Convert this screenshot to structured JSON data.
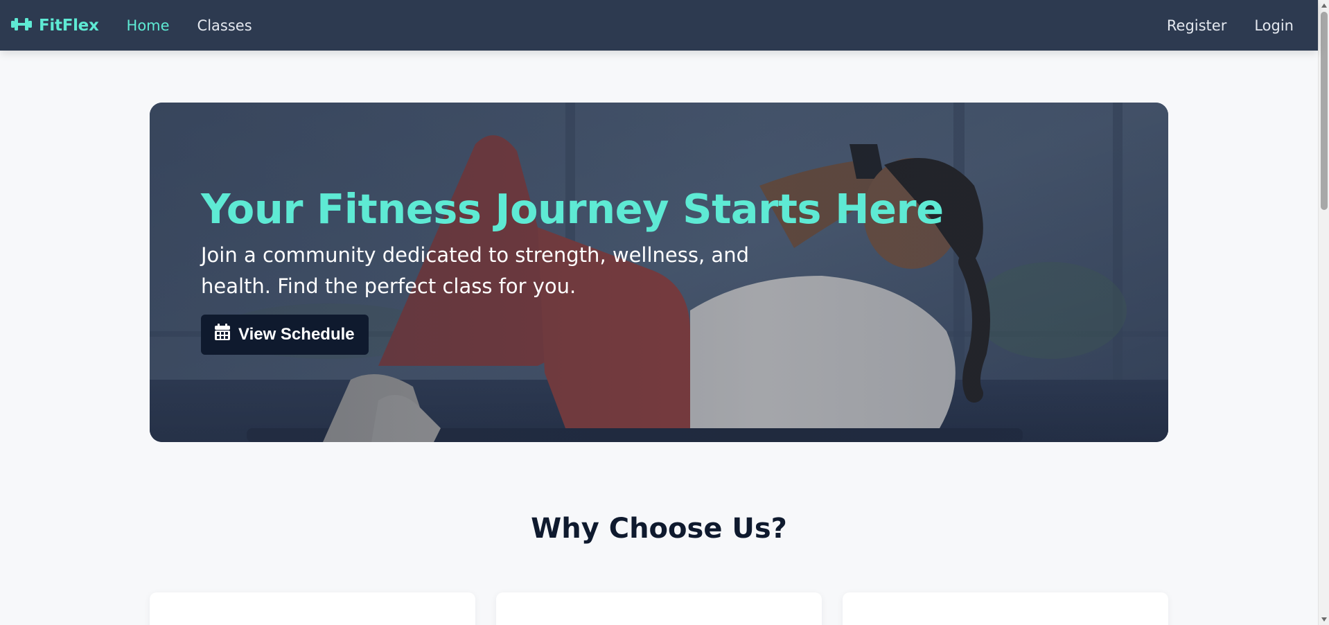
{
  "navbar": {
    "brand": "FitFlex",
    "links": [
      {
        "label": "Home",
        "active": true
      },
      {
        "label": "Classes",
        "active": false
      }
    ],
    "auth": {
      "register": "Register",
      "login": "Login"
    }
  },
  "hero": {
    "title": "Your Fitness Journey Starts Here",
    "subtitle": "Join a community dedicated to strength, wellness, and health. Find the perfect class for you.",
    "cta_label": "View Schedule",
    "cta_icon": "calendar-icon"
  },
  "features": {
    "title": "Why Choose Us?"
  },
  "colors": {
    "accent": "#5eead4",
    "navbar_bg": "#2d3a50",
    "dark": "#0f1a2e",
    "page_bg": "#f7f8fa"
  }
}
